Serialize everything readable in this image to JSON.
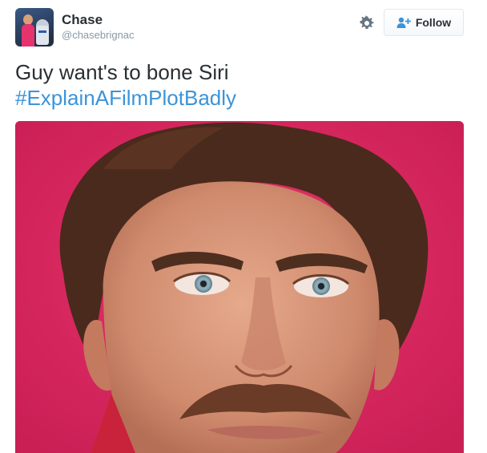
{
  "tweet": {
    "author": {
      "display_name": "Chase",
      "handle": "@chasebrignac"
    },
    "actions": {
      "follow_label": "Follow",
      "settings_icon": "gear-icon",
      "follow_icon": "add-user-icon"
    },
    "text": "Guy want's to bone Siri",
    "hashtag": "#ExplainAFilmPlotBadly",
    "colors": {
      "hashtag": "#3b94d9",
      "text": "#292f33",
      "handle": "#8899a6",
      "media_background": "#dc2a62"
    }
  }
}
